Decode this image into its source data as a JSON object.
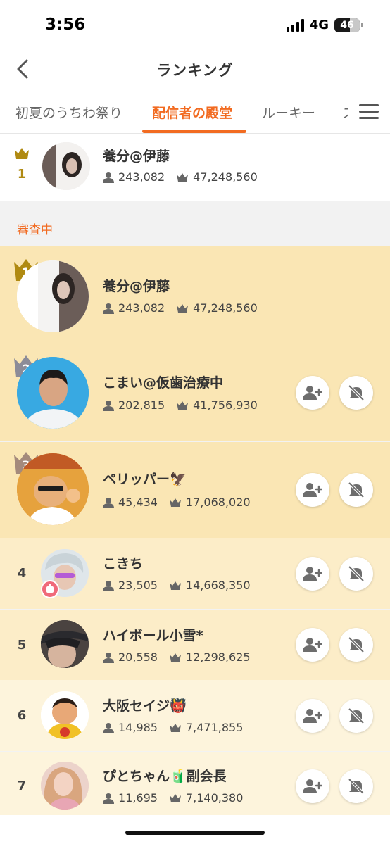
{
  "status": {
    "time": "3:56",
    "network": "4G",
    "battery": "46"
  },
  "header": {
    "title": "ランキング"
  },
  "tabs": [
    {
      "label": "初夏のうちわ祭り"
    },
    {
      "label": "配信者の殿堂"
    },
    {
      "label": "ルーキー"
    },
    {
      "label": "ス"
    }
  ],
  "top_entry": {
    "rank": "1",
    "name": "養分@伊藤",
    "followers": "243,082",
    "points": "47,248,560"
  },
  "section": {
    "label": "審査中"
  },
  "entries": [
    {
      "rank": "1",
      "name": "養分@伊藤",
      "followers": "243,082",
      "points": "47,248,560"
    },
    {
      "rank": "2",
      "name": "こまい@仮歯治療中",
      "followers": "202,815",
      "points": "41,756,930"
    },
    {
      "rank": "3",
      "name": "ペリッパー🦅",
      "followers": "45,434",
      "points": "17,068,020"
    },
    {
      "rank": "4",
      "name": "こきち",
      "followers": "23,505",
      "points": "14,668,350"
    },
    {
      "rank": "5",
      "name": "ハイボール小雪*",
      "followers": "20,558",
      "points": "12,298,625"
    },
    {
      "rank": "6",
      "name": "大阪セイジ👹",
      "followers": "14,985",
      "points": "7,471,855"
    },
    {
      "rank": "7",
      "name": "ぴとちゃん🧃副会長",
      "followers": "11,695",
      "points": "7,140,380"
    }
  ],
  "colors": {
    "accent": "#f26b21",
    "gold": "#b08a12",
    "row_top3": "#fae6b4",
    "row_4_5": "#fcedc8",
    "row_6_7": "#fdf4dc",
    "section_bg": "#f2f2f2"
  },
  "icons": {
    "follow": "person-add-icon",
    "notify": "bell-off-icon",
    "followers": "person-icon",
    "points": "crown-icon"
  }
}
